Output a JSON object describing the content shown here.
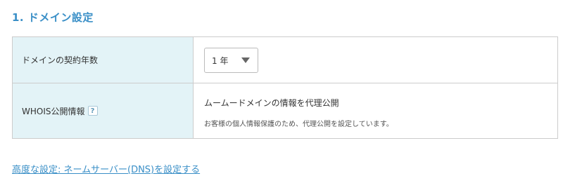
{
  "section": {
    "title": "1. ドメイン設定"
  },
  "rows": {
    "contract": {
      "label": "ドメインの契約年数",
      "select_value": "1 年"
    },
    "whois": {
      "label": "WHOIS公開情報",
      "help_glyph": "?",
      "option_title": "ムームードメインの情報を代理公開",
      "option_desc": "お客様の個人情報保護のため、代理公開を設定しています。"
    }
  },
  "footer": {
    "dns_link": "高度な設定: ネームサーバー(DNS)を設定する"
  },
  "colors": {
    "accent": "#3a8fc7",
    "label_bg": "#e3f3f7",
    "border": "#cccccc"
  }
}
